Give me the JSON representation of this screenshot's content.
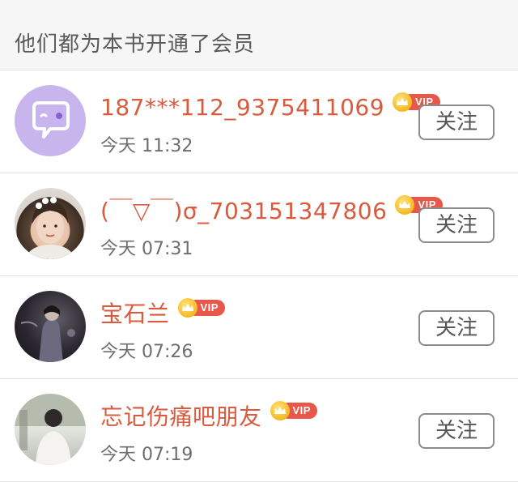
{
  "header": {
    "title": "他们都为本书开通了会员"
  },
  "vip_label": "VIP",
  "colors": {
    "name": "#d95a3d",
    "vip_badge": "#e8584a",
    "crown": "#f5b820"
  },
  "users": [
    {
      "name": "187***112_9375411069",
      "time": "今天 11:32",
      "follow_label": "关注",
      "avatar": "chat-bubble-icon"
    },
    {
      "name": "(￣▽￣)σ_703151347806",
      "time": "今天 07:31",
      "follow_label": "关注",
      "avatar": "photo-woman-portrait"
    },
    {
      "name": "宝石兰",
      "time": "今天 07:26",
      "follow_label": "关注",
      "avatar": "photo-dark-figure"
    },
    {
      "name": "忘记伤痛吧朋友",
      "time": "今天 07:19",
      "follow_label": "关注",
      "avatar": "photo-person-outdoor"
    }
  ]
}
